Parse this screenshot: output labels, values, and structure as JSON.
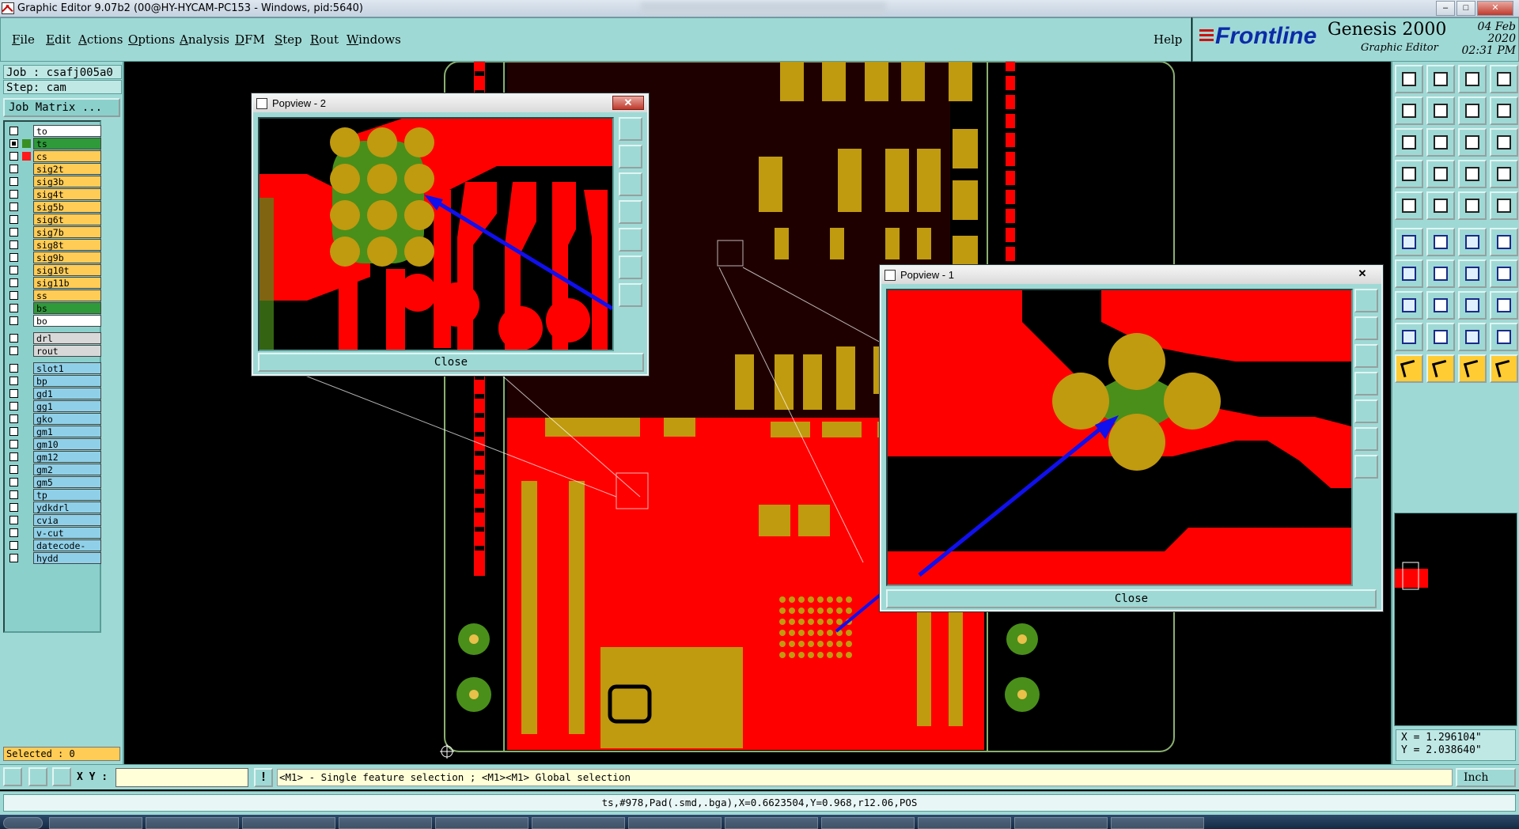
{
  "window": {
    "title": "Graphic Editor 9.07b2 (00@HY-HYCAM-PC153 - Windows, pid:5640)",
    "controls": [
      "–",
      "□",
      "✕"
    ]
  },
  "menubar": {
    "items": [
      "File",
      "Edit",
      "Actions",
      "Options",
      "Analysis",
      "DFM",
      "Step",
      "Rout",
      "Windows"
    ],
    "help": "Help"
  },
  "brand": {
    "logo": "Frontline",
    "product": "Genesis 2000",
    "subtitle": "Graphic Editor",
    "date": "04 Feb 2020",
    "time": "02:31 PM"
  },
  "job": {
    "job_line": "Job : csafj005a0",
    "step_line": "Step: cam",
    "matrix_button": "Job Matrix ..."
  },
  "layers": [
    {
      "name": "to",
      "color": "#ffffff",
      "swatch": "",
      "on": false,
      "mark": "⬋"
    },
    {
      "name": "ts",
      "color": "#2e9a3a",
      "swatch": "#3a8f22",
      "on": true,
      "mark": "≡"
    },
    {
      "name": "cs",
      "color": "#ffcc55",
      "swatch": "#ff1a1a",
      "on": false,
      "mark": ""
    },
    {
      "name": "sig2t",
      "color": "#ffcc55",
      "swatch": "",
      "on": false,
      "mark": ""
    },
    {
      "name": "sig3b",
      "color": "#ffcc55",
      "swatch": "",
      "on": false,
      "mark": ""
    },
    {
      "name": "sig4t",
      "color": "#ffcc55",
      "swatch": "",
      "on": false,
      "mark": ""
    },
    {
      "name": "sig5b",
      "color": "#ffcc55",
      "swatch": "",
      "on": false,
      "mark": "⬋"
    },
    {
      "name": "sig6t",
      "color": "#ffcc55",
      "swatch": "",
      "on": false,
      "mark": ""
    },
    {
      "name": "sig7b",
      "color": "#ffcc55",
      "swatch": "",
      "on": false,
      "mark": ""
    },
    {
      "name": "sig8t",
      "color": "#ffcc55",
      "swatch": "",
      "on": false,
      "mark": ""
    },
    {
      "name": "sig9b",
      "color": "#ffcc55",
      "swatch": "",
      "on": false,
      "mark": ""
    },
    {
      "name": "sig10t",
      "color": "#ffcc55",
      "swatch": "",
      "on": false,
      "mark": ""
    },
    {
      "name": "sig11b",
      "color": "#ffcc55",
      "swatch": "",
      "on": false,
      "mark": ""
    },
    {
      "name": "ss",
      "color": "#ffcc55",
      "swatch": "",
      "on": false,
      "mark": "⬋"
    },
    {
      "name": "bs",
      "color": "#2e9a3a",
      "swatch": "",
      "on": false,
      "mark": ""
    },
    {
      "name": "bo",
      "color": "#ffffff",
      "swatch": "",
      "on": false,
      "mark": ""
    },
    {
      "name": "drl",
      "color": "#d8d8d8",
      "swatch": "",
      "on": false,
      "mark": ""
    },
    {
      "name": "rout",
      "color": "#d8d8d8",
      "swatch": "",
      "on": false,
      "mark": ""
    },
    {
      "name": "slot1",
      "color": "#8fd0e8",
      "swatch": "",
      "on": false,
      "mark": ""
    },
    {
      "name": "bp",
      "color": "#8fd0e8",
      "swatch": "",
      "on": false,
      "mark": "⬋"
    },
    {
      "name": "gd1",
      "color": "#8fd0e8",
      "swatch": "",
      "on": false,
      "mark": "⬋"
    },
    {
      "name": "gg1",
      "color": "#8fd0e8",
      "swatch": "",
      "on": false,
      "mark": ""
    },
    {
      "name": "gko",
      "color": "#8fd0e8",
      "swatch": "",
      "on": false,
      "mark": ""
    },
    {
      "name": "gm1",
      "color": "#8fd0e8",
      "swatch": "",
      "on": false,
      "mark": ""
    },
    {
      "name": "gm10",
      "color": "#8fd0e8",
      "swatch": "",
      "on": false,
      "mark": ""
    },
    {
      "name": "gm12",
      "color": "#8fd0e8",
      "swatch": "",
      "on": false,
      "mark": ""
    },
    {
      "name": "gm2",
      "color": "#8fd0e8",
      "swatch": "",
      "on": false,
      "mark": ""
    },
    {
      "name": "gm5",
      "color": "#8fd0e8",
      "swatch": "",
      "on": false,
      "mark": "⬋"
    },
    {
      "name": "tp",
      "color": "#8fd0e8",
      "swatch": "",
      "on": false,
      "mark": "⬋"
    },
    {
      "name": "ydkdrl",
      "color": "#8fd0e8",
      "swatch": "",
      "on": false,
      "mark": ""
    },
    {
      "name": "cvia",
      "color": "#8fd0e8",
      "swatch": "",
      "on": false,
      "mark": ""
    },
    {
      "name": "v-cut",
      "color": "#8fd0e8",
      "swatch": "",
      "on": false,
      "mark": ""
    },
    {
      "name": "datecode-pte",
      "color": "#8fd0e8",
      "swatch": "",
      "on": false,
      "mark": ""
    },
    {
      "name": "hydd",
      "color": "#8fd0e8",
      "swatch": "",
      "on": false,
      "mark": ""
    }
  ],
  "selected": "Selected : 0",
  "popview2": {
    "title": "Popview - 2",
    "close_label": "Close",
    "x_glyph": "✕"
  },
  "popview1": {
    "title": "Popview - 1",
    "close_label": "Close",
    "x_glyph": "✕"
  },
  "colors": {
    "copper": "#ff0000",
    "pad": "#c09a0f",
    "solder": "#4a8f1a",
    "arrow": "#1010ee",
    "panel": "#9fd9d5"
  },
  "coords": {
    "x": "X = 1.296104\"",
    "y": "Y = 2.038640\""
  },
  "bottom": {
    "xy_label": "X Y :",
    "xy_value": "",
    "hint": "<M1> - Single feature selection ; <M1><M1> Global selection",
    "units": "Inch"
  },
  "status": "ts,#978,Pad(.smd,.bga),X=0.6623504,Y=0.968,r12.06,POS"
}
